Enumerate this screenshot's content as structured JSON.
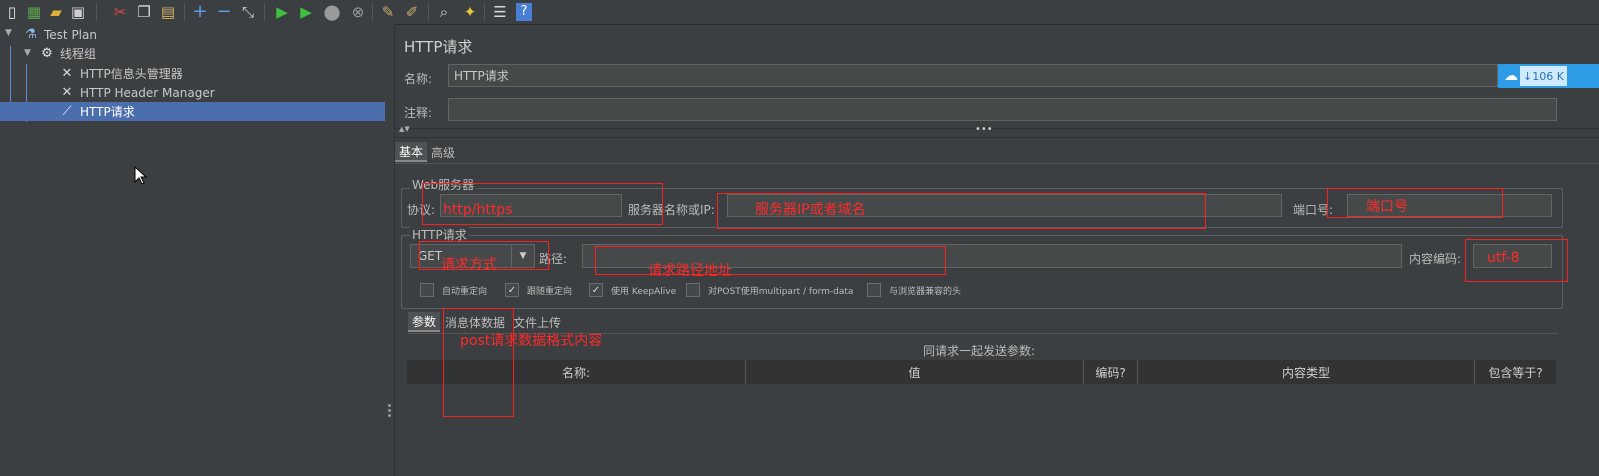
{
  "toolbar": {
    "icons": [
      "new-icon",
      "templates-icon",
      "open-icon",
      "save-icon",
      "cut-icon",
      "copy-icon",
      "paste-icon",
      "expand-icon",
      "collapse-icon",
      "toggle-icon",
      "start-icon",
      "start-no-pause-icon",
      "stop-icon",
      "shutdown-icon",
      "clear-icon",
      "clear-all-icon",
      "search-icon",
      "reset-search-icon",
      "function-helper-icon",
      "help-icon"
    ]
  },
  "tree": {
    "test_plan": "Test Plan",
    "thread_group": "线程组",
    "items": [
      {
        "label": "HTTP信息头管理器",
        "icon": "wrench-icon"
      },
      {
        "label": "HTTP Header Manager",
        "icon": "wrench-icon"
      },
      {
        "label": "HTTP请求",
        "icon": "pipette-icon"
      }
    ]
  },
  "panel": {
    "title": "HTTP请求",
    "name_label": "名称:",
    "name_value": "HTTP请求",
    "comment_label": "注释:",
    "comment_value": "",
    "tabs": [
      "基本",
      "高级"
    ],
    "web_server_title": "Web服务器",
    "protocol_label": "协议:",
    "server_label": "服务器名称或IP:",
    "port_label": "端口号:",
    "http_request_title": "HTTP请求",
    "method": "GET",
    "path_label": "路径:",
    "encoding_label": "内容编码:",
    "checkboxes": [
      {
        "label": "自动重定向",
        "checked": false
      },
      {
        "label": "跟随重定向",
        "checked": true
      },
      {
        "label": "使用 KeepAlive",
        "checked": true
      },
      {
        "label": "对POST使用multipart / form-data",
        "checked": false
      },
      {
        "label": "与浏览器兼容的头",
        "checked": false
      }
    ],
    "sub_tabs": [
      "参数",
      "消息体数据",
      "文件上传"
    ],
    "send_params_label": "同请求一起发送参数:",
    "table_columns": [
      "名称:",
      "值",
      "编码?",
      "内容类型",
      "包含等于?"
    ]
  },
  "annotations": {
    "protocol": "http/https",
    "server": "服务器IP或者域名",
    "port": "端口号",
    "method": "请求方式",
    "path": "请求路径地址",
    "encoding": "utf-8",
    "body": "post请求数据格式内容"
  },
  "overlay": {
    "speed": "↓106 K"
  }
}
